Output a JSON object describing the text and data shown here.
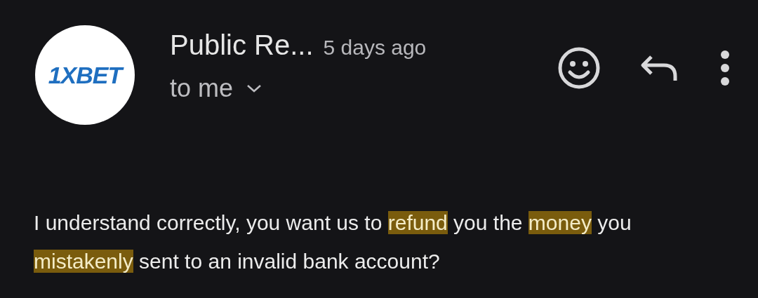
{
  "sender": {
    "logo_text": "1XBET",
    "name": "Public Re...",
    "time": "5 days ago",
    "recipient": "to me"
  },
  "body": [
    {
      "text": "I understand correctly, you want us to ",
      "highlighted": false
    },
    {
      "text": "refund",
      "highlighted": true
    },
    {
      "text": " you the ",
      "highlighted": false
    },
    {
      "text": "money",
      "highlighted": true
    },
    {
      "text": " you ",
      "highlighted": false
    },
    {
      "text": "mistakenly",
      "highlighted": true
    },
    {
      "text": " sent to an invalid bank account?",
      "highlighted": false
    }
  ]
}
